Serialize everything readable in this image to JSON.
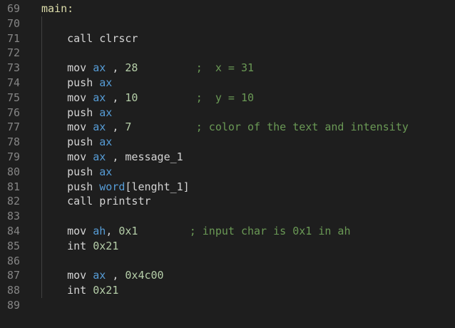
{
  "editor": {
    "lines": [
      {
        "num": "69",
        "indent": 0,
        "guide": false,
        "tokens": [
          {
            "t": "main:",
            "c": "label"
          }
        ]
      },
      {
        "num": "70",
        "indent": 0,
        "guide": true,
        "tokens": []
      },
      {
        "num": "71",
        "indent": 1,
        "guide": true,
        "tokens": [
          {
            "t": "call clrscr",
            "c": "plain"
          }
        ]
      },
      {
        "num": "72",
        "indent": 0,
        "guide": true,
        "tokens": []
      },
      {
        "num": "73",
        "indent": 1,
        "guide": true,
        "tokens": [
          {
            "t": "mov ",
            "c": "plain"
          },
          {
            "t": "ax",
            "c": "reg"
          },
          {
            "t": " , ",
            "c": "plain"
          },
          {
            "t": "28",
            "c": "num"
          },
          {
            "t": "         ;  x = 31",
            "c": "comment"
          }
        ]
      },
      {
        "num": "74",
        "indent": 1,
        "guide": true,
        "tokens": [
          {
            "t": "push ",
            "c": "plain"
          },
          {
            "t": "ax",
            "c": "reg"
          }
        ]
      },
      {
        "num": "75",
        "indent": 1,
        "guide": true,
        "tokens": [
          {
            "t": "mov ",
            "c": "plain"
          },
          {
            "t": "ax",
            "c": "reg"
          },
          {
            "t": " , ",
            "c": "plain"
          },
          {
            "t": "10",
            "c": "num"
          },
          {
            "t": "         ;  y = 10",
            "c": "comment"
          }
        ]
      },
      {
        "num": "76",
        "indent": 1,
        "guide": true,
        "tokens": [
          {
            "t": "push ",
            "c": "plain"
          },
          {
            "t": "ax",
            "c": "reg"
          }
        ]
      },
      {
        "num": "77",
        "indent": 1,
        "guide": true,
        "tokens": [
          {
            "t": "mov ",
            "c": "plain"
          },
          {
            "t": "ax",
            "c": "reg"
          },
          {
            "t": " , ",
            "c": "plain"
          },
          {
            "t": "7",
            "c": "num"
          },
          {
            "t": "          ; color of the text and intensity",
            "c": "comment"
          }
        ]
      },
      {
        "num": "78",
        "indent": 1,
        "guide": true,
        "tokens": [
          {
            "t": "push ",
            "c": "plain"
          },
          {
            "t": "ax",
            "c": "reg"
          }
        ]
      },
      {
        "num": "79",
        "indent": 1,
        "guide": true,
        "tokens": [
          {
            "t": "mov ",
            "c": "plain"
          },
          {
            "t": "ax",
            "c": "reg"
          },
          {
            "t": " , message_1",
            "c": "plain"
          }
        ]
      },
      {
        "num": "80",
        "indent": 1,
        "guide": true,
        "tokens": [
          {
            "t": "push ",
            "c": "plain"
          },
          {
            "t": "ax",
            "c": "reg"
          }
        ]
      },
      {
        "num": "81",
        "indent": 1,
        "guide": true,
        "tokens": [
          {
            "t": "push ",
            "c": "plain"
          },
          {
            "t": "word",
            "c": "reg"
          },
          {
            "t": "[lenght_1]",
            "c": "plain"
          }
        ]
      },
      {
        "num": "82",
        "indent": 1,
        "guide": true,
        "tokens": [
          {
            "t": "call printstr",
            "c": "plain"
          }
        ]
      },
      {
        "num": "83",
        "indent": 0,
        "guide": true,
        "tokens": []
      },
      {
        "num": "84",
        "indent": 1,
        "guide": true,
        "tokens": [
          {
            "t": "mov ",
            "c": "plain"
          },
          {
            "t": "ah",
            "c": "reg"
          },
          {
            "t": ", ",
            "c": "plain"
          },
          {
            "t": "0x1",
            "c": "num"
          },
          {
            "t": "        ; input char is 0x1 in ah",
            "c": "comment"
          }
        ]
      },
      {
        "num": "85",
        "indent": 1,
        "guide": true,
        "tokens": [
          {
            "t": "int ",
            "c": "plain"
          },
          {
            "t": "0x21",
            "c": "num"
          }
        ]
      },
      {
        "num": "86",
        "indent": 0,
        "guide": true,
        "tokens": []
      },
      {
        "num": "87",
        "indent": 1,
        "guide": true,
        "tokens": [
          {
            "t": "mov ",
            "c": "plain"
          },
          {
            "t": "ax",
            "c": "reg"
          },
          {
            "t": " , ",
            "c": "plain"
          },
          {
            "t": "0x4c00",
            "c": "num"
          }
        ]
      },
      {
        "num": "88",
        "indent": 1,
        "guide": true,
        "tokens": [
          {
            "t": "int ",
            "c": "plain"
          },
          {
            "t": "0x21",
            "c": "num"
          }
        ]
      },
      {
        "num": "89",
        "indent": 0,
        "guide": false,
        "tokens": []
      }
    ]
  },
  "colors": {
    "background": "#1e1e1e",
    "line_number": "#858585",
    "label": "#dcdcaa",
    "register": "#569cd6",
    "number": "#b5cea8",
    "comment": "#6a9955",
    "text": "#d4d4d4"
  }
}
